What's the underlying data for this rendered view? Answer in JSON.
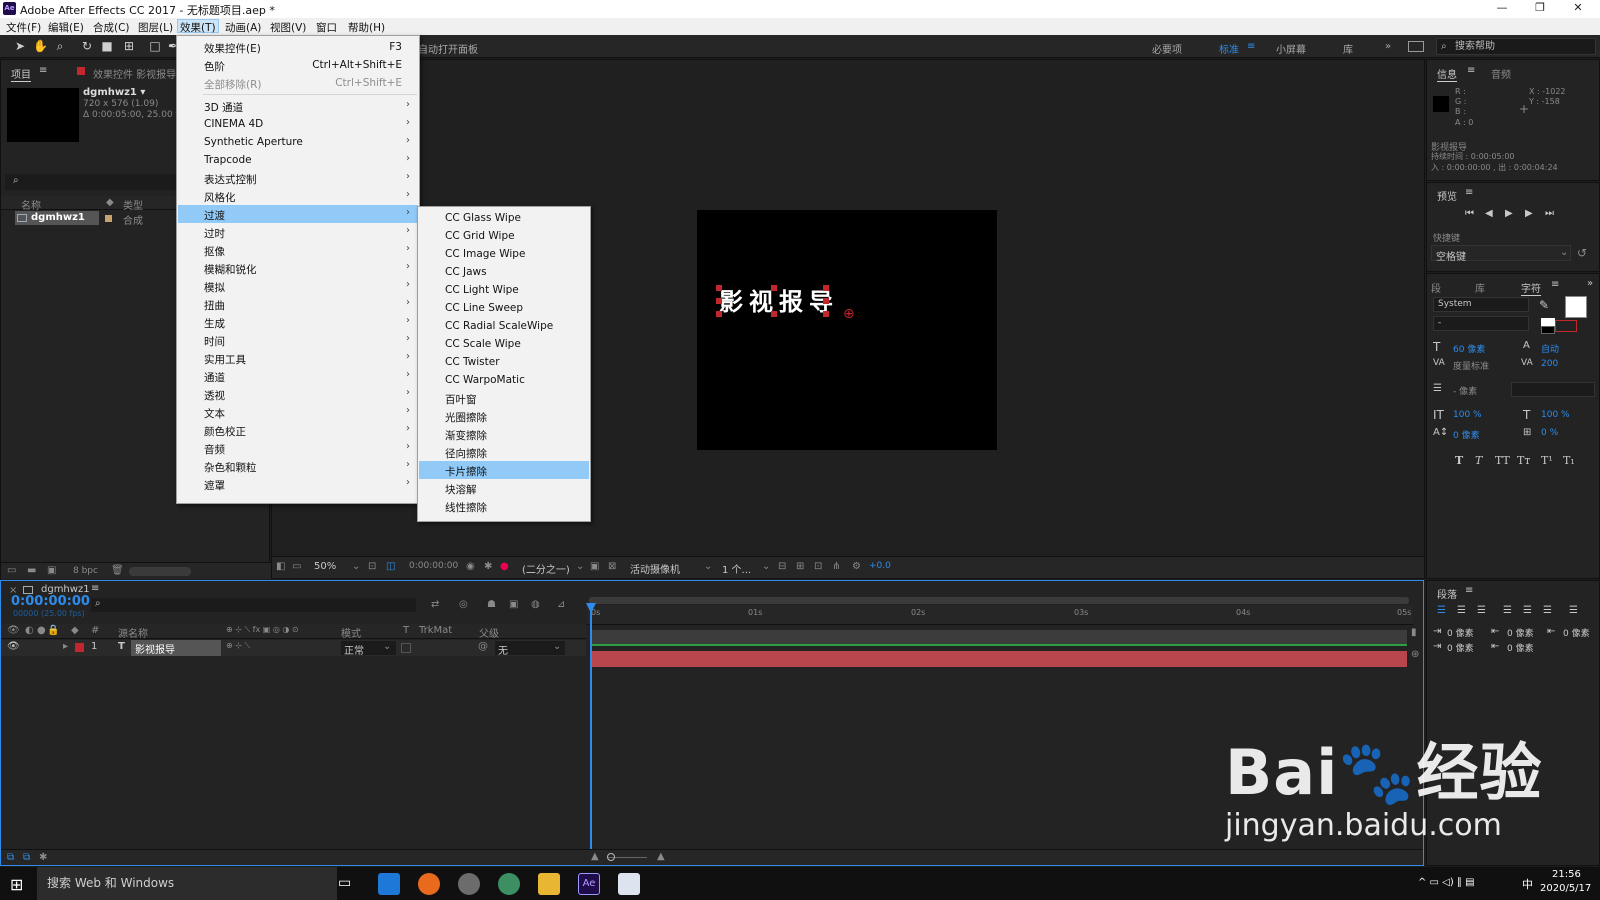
{
  "titlebar": {
    "logo": "Ae",
    "title": "Adobe After Effects CC 2017 - 无标题项目.aep *",
    "minimize": "—",
    "restore": "❐",
    "close": "✕"
  },
  "menubar": [
    {
      "label": "文件(F)"
    },
    {
      "label": "编辑(E)"
    },
    {
      "label": "合成(C)"
    },
    {
      "label": "图层(L)"
    },
    {
      "label": "效果(T)",
      "active": true
    },
    {
      "label": "动画(A)"
    },
    {
      "label": "视图(V)"
    },
    {
      "label": "窗口"
    },
    {
      "label": "帮助(H)"
    }
  ],
  "toolbar": {
    "tools": [
      "selection-tool-icon",
      "hand-tool-icon",
      "zoom-tool-icon",
      "rotate-tool-icon",
      "camera-tool-icon",
      "pan-behind-icon",
      "rectangle-tool-icon",
      "pen-tool-icon"
    ],
    "auto_open": "自动打开面板",
    "workspaces": [
      {
        "label": "必要项"
      },
      {
        "label": "标准",
        "active": true
      },
      {
        "label": "小屏幕"
      },
      {
        "label": "库"
      }
    ],
    "overflow": "»",
    "help_placeholder": "搜索帮助"
  },
  "project_panel": {
    "tab_project": "项目",
    "tab_effect_controls": "效果控件 影视报导",
    "item_name": "dgmhwz1 ▾",
    "item_info1": "720 x 576 (1.09)",
    "item_info2": "Δ 0:00:05:00, 25.00 f",
    "col_name": "名称",
    "col_type": "类型",
    "row_name": "dgmhwz1",
    "row_type": "合成",
    "bpc": "8 bpc"
  },
  "effects_menu": {
    "items": [
      {
        "label": "效果控件(E)",
        "shortcut": "F3"
      },
      {
        "label": "色阶",
        "shortcut": "Ctrl+Alt+Shift+E"
      },
      {
        "label": "全部移除(R)",
        "shortcut": "Ctrl+Shift+E",
        "disabled": true
      },
      {
        "label": "3D 通道",
        "submenu": true
      },
      {
        "label": "CINEMA 4D",
        "submenu": true
      },
      {
        "label": "Synthetic Aperture",
        "submenu": true
      },
      {
        "label": "Trapcode",
        "submenu": true
      },
      {
        "label": "表达式控制",
        "submenu": true
      },
      {
        "label": "风格化",
        "submenu": true
      },
      {
        "label": "过渡",
        "submenu": true,
        "highlight": true
      },
      {
        "label": "过时",
        "submenu": true
      },
      {
        "label": "抠像",
        "submenu": true
      },
      {
        "label": "模糊和锐化",
        "submenu": true
      },
      {
        "label": "模拟",
        "submenu": true
      },
      {
        "label": "扭曲",
        "submenu": true
      },
      {
        "label": "生成",
        "submenu": true
      },
      {
        "label": "时间",
        "submenu": true
      },
      {
        "label": "实用工具",
        "submenu": true
      },
      {
        "label": "通道",
        "submenu": true
      },
      {
        "label": "透视",
        "submenu": true
      },
      {
        "label": "文本",
        "submenu": true
      },
      {
        "label": "颜色校正",
        "submenu": true
      },
      {
        "label": "音频",
        "submenu": true
      },
      {
        "label": "杂色和颗粒",
        "submenu": true
      },
      {
        "label": "遮罩",
        "submenu": true
      }
    ]
  },
  "transition_submenu": {
    "items": [
      {
        "label": "CC Glass Wipe"
      },
      {
        "label": "CC Grid Wipe"
      },
      {
        "label": "CC Image Wipe"
      },
      {
        "label": "CC Jaws"
      },
      {
        "label": "CC Light Wipe"
      },
      {
        "label": "CC Line Sweep"
      },
      {
        "label": "CC Radial ScaleWipe"
      },
      {
        "label": "CC Scale Wipe"
      },
      {
        "label": "CC Twister"
      },
      {
        "label": "CC WarpoMatic"
      },
      {
        "label": "百叶窗"
      },
      {
        "label": "光圈擦除"
      },
      {
        "label": "渐变擦除"
      },
      {
        "label": "径向擦除"
      },
      {
        "label": "卡片擦除",
        "highlight": true
      },
      {
        "label": "块溶解"
      },
      {
        "label": "线性擦除"
      }
    ]
  },
  "composition": {
    "text": "影视报导"
  },
  "viewer_bar": {
    "zoom": "50%",
    "timecode": "0:00:00:00",
    "resolution": "(二分之一)",
    "camera": "活动摄像机",
    "views": "1 个...",
    "exposure": "+0.0"
  },
  "info_panel": {
    "tab_info": "信息",
    "tab_audio": "音频",
    "r": "R :",
    "g": "G :",
    "b": "B :",
    "a": "A : 0",
    "x": "X : -1022",
    "y": "Y : -158",
    "layer": "影视报导",
    "duration": "持续时间 : 0:00:05:00",
    "inout": "入 : 0:00:00:00 , 出 : 0:00:04:24"
  },
  "preview_panel": {
    "title": "预览",
    "shortcut_label": "快捷键",
    "shortcut_value": "空格键"
  },
  "character_panel": {
    "tab_seg": "段",
    "tab_lib": "库",
    "tab_char": "字符",
    "font": "System",
    "style": "-",
    "size": "60 像素",
    "leading": "自动",
    "kerning": "度量标准",
    "tracking": "200",
    "stroke": "- 像素",
    "vscale": "100 %",
    "hscale": "100 %",
    "baseline": "0 像素",
    "tsume": "0 %",
    "styles": [
      "T",
      "T",
      "TT",
      "Tт",
      "T¹",
      "T₁"
    ]
  },
  "paragraph_panel": {
    "title": "段落",
    "indent1": "0 像素",
    "indent2": "0 像素",
    "indent3": "0 像素",
    "space1": "0 像素",
    "space2": "0 像素"
  },
  "timeline": {
    "tab": "dgmhwz1",
    "timecode": "0:00:00:00",
    "frames": "00000 (25.00 fps)",
    "col_source": "源名称",
    "col_mode": "模式",
    "col_t": "T",
    "col_trkmat": "TrkMat",
    "col_parent": "父级",
    "layer_index": "1",
    "layer_type": "T",
    "layer_name": "影视报导",
    "layer_mode": "正常",
    "layer_parent": "无",
    "ruler": [
      "0s",
      "01s",
      "02s",
      "03s",
      "04s",
      "05s"
    ]
  },
  "taskbar": {
    "search": "搜索 Web 和 Windows",
    "time": "21:56",
    "date": "2020/5/17",
    "ime": "中"
  },
  "watermark": {
    "line1": "Bai🐾经验",
    "line2": "jingyan.baidu.com"
  }
}
